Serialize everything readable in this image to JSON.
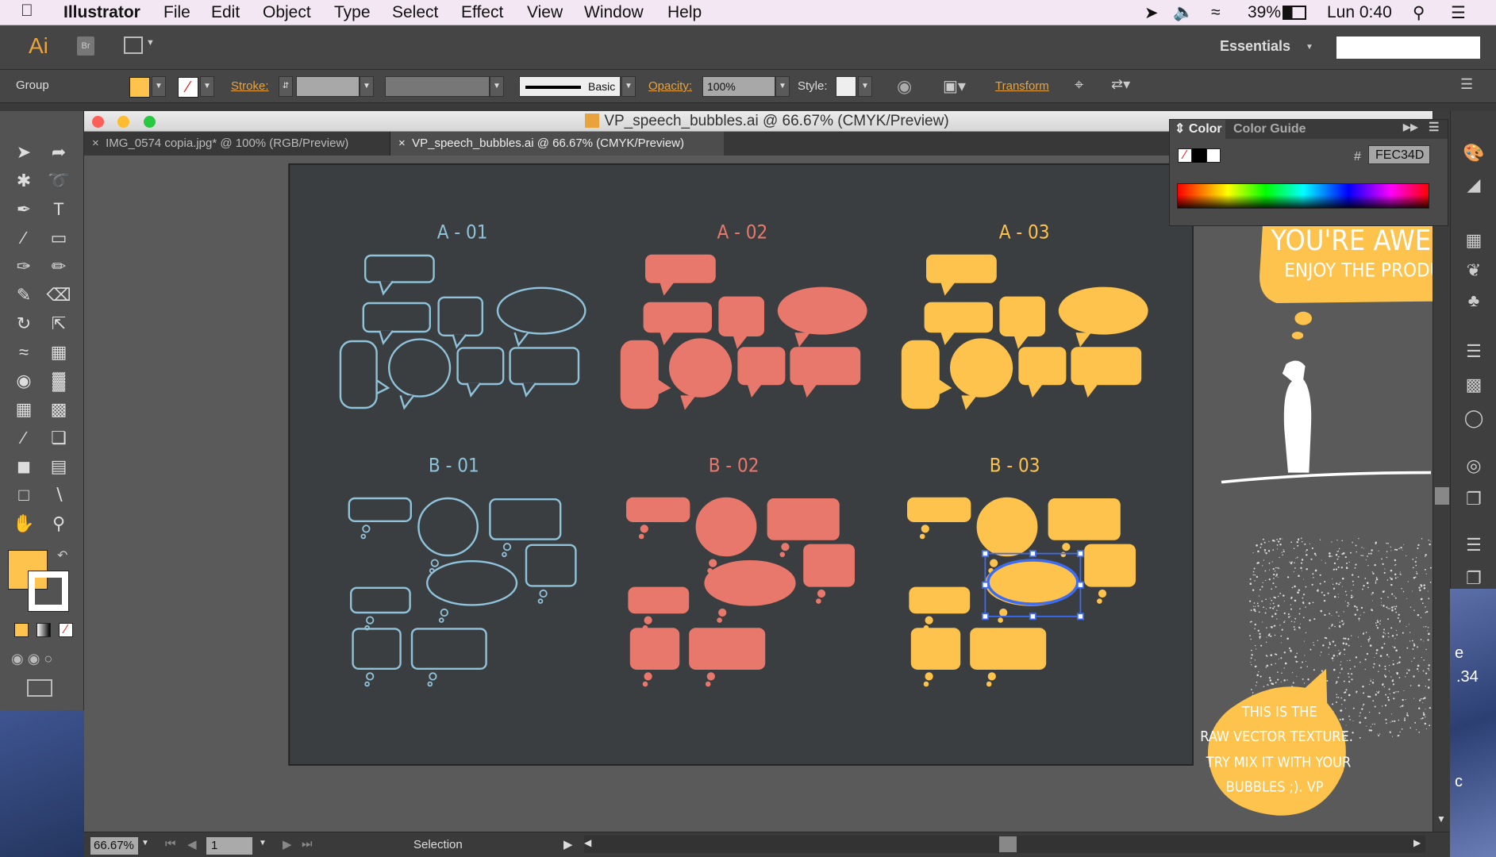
{
  "menubar": {
    "app": "Illustrator",
    "items": [
      "File",
      "Edit",
      "Object",
      "Type",
      "Select",
      "Effect",
      "View",
      "Window",
      "Help"
    ],
    "battery": "39%",
    "clock": "Lun 0:40"
  },
  "appbar": {
    "logo": "Ai",
    "bridge": "Br",
    "workspace": "Essentials"
  },
  "control": {
    "selection": "Group",
    "stroke_label": "Stroke:",
    "brush": "Basic",
    "opacity_label": "Opacity:",
    "opacity": "100%",
    "style_label": "Style:",
    "transform": "Transform"
  },
  "document": {
    "title": "VP_speech_bubbles.ai @ 66.67% (CMYK/Preview)",
    "tabs": [
      {
        "label": "IMG_0574 copia.jpg* @ 100% (RGB/Preview)",
        "active": false
      },
      {
        "label": "VP_speech_bubbles.ai @ 66.67% (CMYK/Preview)",
        "active": true
      }
    ]
  },
  "artboard": {
    "labels": [
      "A - 01",
      "A - 02",
      "A - 03",
      "B - 01",
      "B - 02",
      "B - 03"
    ],
    "top_bubble": [
      "YOU'RE AWESOME",
      "ENJOY THE PRODUCT. :)"
    ],
    "bottom_bubble": [
      "THIS IS THE",
      "RAW VECTOR TEXTURE.",
      "TRY MIX IT WITH YOUR",
      "BUBBLES ;). VP"
    ]
  },
  "colors": {
    "outline": "#8fc3dc",
    "salmon": "#e8786b",
    "yellow": "#fec34d",
    "artboard": "#3b3e40",
    "selection": "#3d6cf0"
  },
  "color_panel": {
    "tabs": [
      "Color",
      "Color Guide"
    ],
    "hash": "#",
    "hex": "FEC34D"
  },
  "status": {
    "zoom": "66.67%",
    "page": "1",
    "tool": "Selection"
  },
  "desktop": {
    "text1": "e",
    "text2": ".34",
    "text3": "c"
  }
}
